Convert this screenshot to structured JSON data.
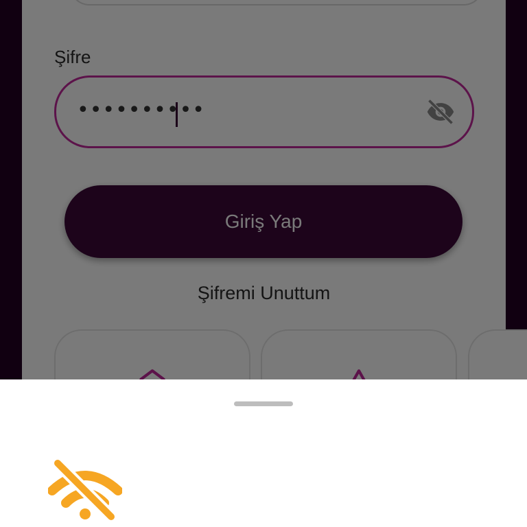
{
  "login": {
    "password_label": "Şifre",
    "password_value": "••••••••••",
    "login_button": "Giriş Yap",
    "forgot_password": "Şifremi Unuttum"
  },
  "icons": {
    "password_toggle": "eye-off-icon",
    "sheet_status": "wifi-off-icon"
  },
  "colors": {
    "brand_dark": "#3d0a3a",
    "field_border": "#c0289b",
    "warning": "#f6a623"
  }
}
